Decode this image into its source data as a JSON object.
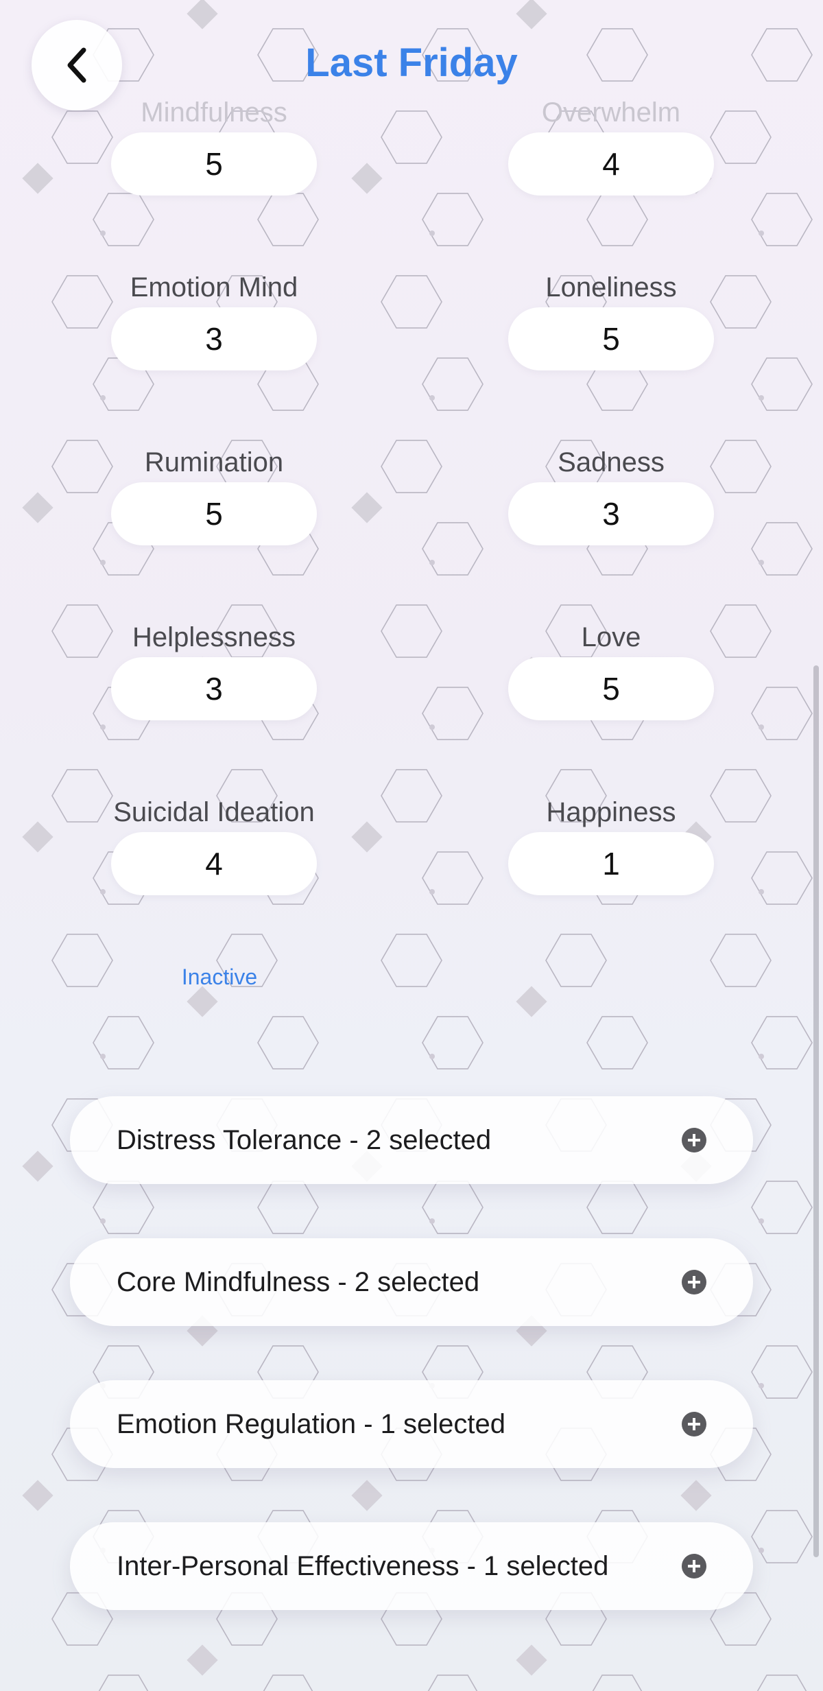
{
  "header": {
    "title": "Last Friday",
    "back_icon": "chevron-left-icon"
  },
  "metrics": [
    {
      "label": "Mindfulness",
      "value": "5"
    },
    {
      "label": "Overwhelm",
      "value": "4"
    },
    {
      "label": "Emotion Mind",
      "value": "3"
    },
    {
      "label": "Loneliness",
      "value": "5"
    },
    {
      "label": "Rumination",
      "value": "5"
    },
    {
      "label": "Sadness",
      "value": "3"
    },
    {
      "label": "Helplessness",
      "value": "3"
    },
    {
      "label": "Love",
      "value": "5"
    },
    {
      "label": "Suicidal Ideation",
      "value": "4"
    },
    {
      "label": "Happiness",
      "value": "1"
    }
  ],
  "status_link": "Inactive",
  "skill_groups": [
    {
      "label": "Distress Tolerance - 2 selected",
      "icon": "plus-circle-icon"
    },
    {
      "label": "Core Mindfulness - 2 selected",
      "icon": "plus-circle-icon"
    },
    {
      "label": "Emotion Regulation - 1 selected",
      "icon": "plus-circle-icon"
    },
    {
      "label": "Inter-Personal Effectiveness - 1 selected",
      "icon": "plus-circle-icon"
    }
  ],
  "colors": {
    "accent": "#3b82e8",
    "text": "#1c1c1e",
    "label": "#4a4a4f"
  }
}
